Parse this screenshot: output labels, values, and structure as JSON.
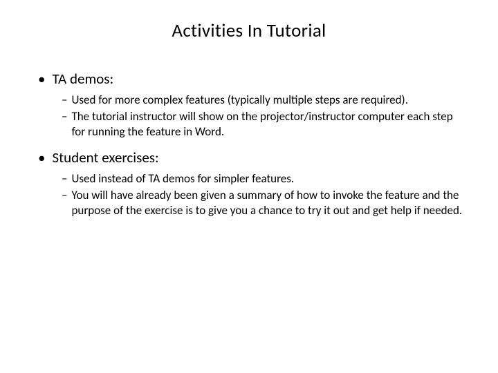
{
  "title": "Activities In Tutorial",
  "bullets": [
    {
      "label": "TA demos:",
      "subs": [
        "Used for more complex features (typically multiple steps are required).",
        "The tutorial instructor will show on the projector/instructor  computer each step for running the feature in Word."
      ]
    },
    {
      "label": "Student exercises:",
      "subs": [
        "Used instead of TA demos for simpler features.",
        "You will have already been given a summary of how to invoke the feature and the purpose of the exercise is to give you a chance to try it out and get help if needed."
      ]
    }
  ]
}
